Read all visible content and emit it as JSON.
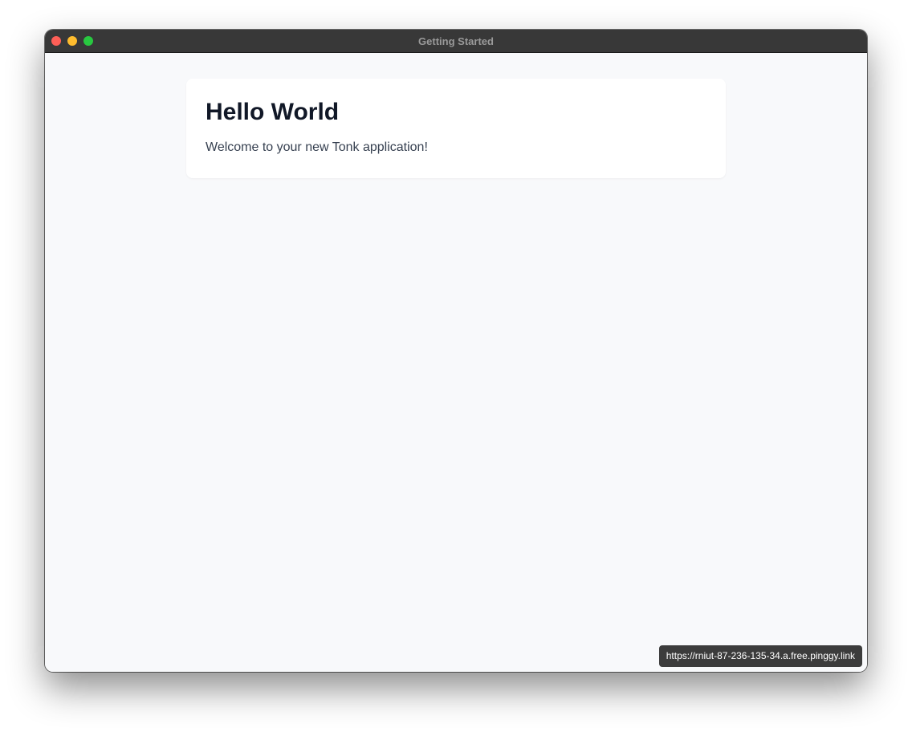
{
  "window": {
    "title": "Getting Started"
  },
  "card": {
    "heading": "Hello World",
    "body": "Welcome to your new Tonk application!"
  },
  "status_bar": {
    "url": "https://rniut-87-236-135-34.a.free.pinggy.link"
  },
  "colors": {
    "close": "#fe5f57",
    "minimize": "#febc2e",
    "maximize": "#28c840",
    "titlebar": "#383838",
    "background": "#f8f9fb",
    "card": "#ffffff"
  }
}
